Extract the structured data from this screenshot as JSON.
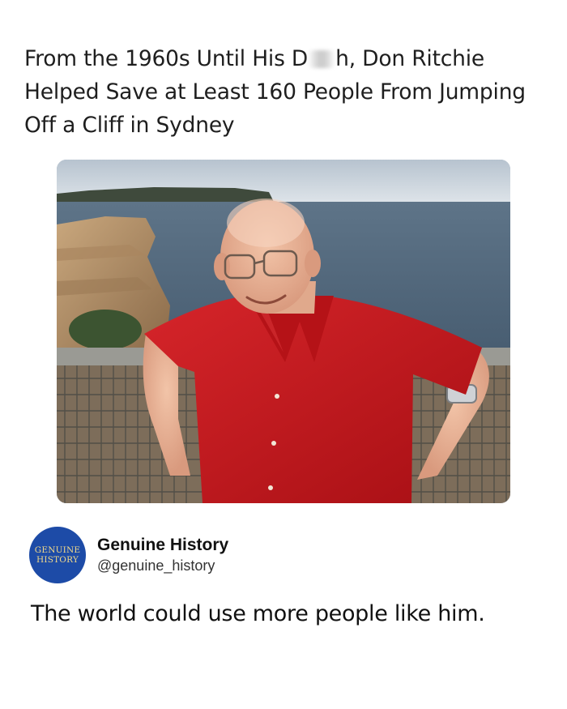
{
  "post": {
    "title_part1": "From the 1960s Until His D",
    "title_part2": "h, Don Ritchie Helped Save at Least 160 People From Jumping Off a Cliff in Sydney",
    "body": "The world could use more people like him."
  },
  "author": {
    "name": "Genuine History",
    "handle": "@genuine_history",
    "avatar_line1": "GENUINE",
    "avatar_line2": "HISTORY"
  },
  "colors": {
    "avatar_bg": "#1d4ba7",
    "avatar_text": "#f1d98a",
    "shirt": "#c8171b"
  }
}
